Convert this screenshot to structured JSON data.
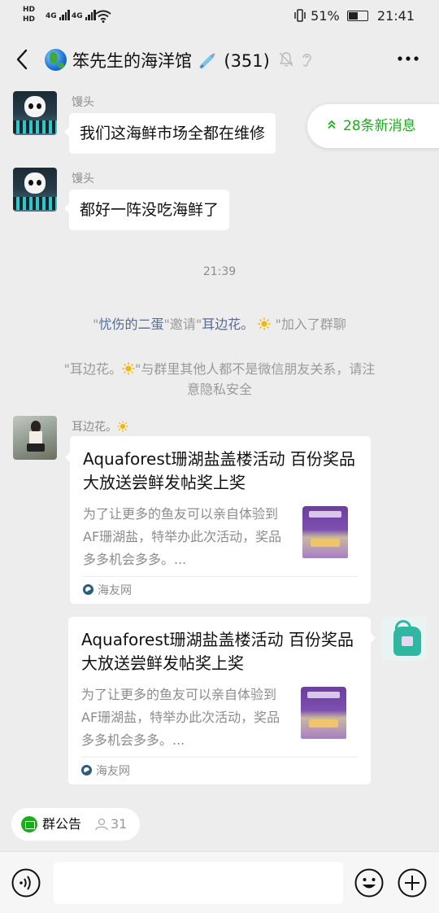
{
  "status_bar": {
    "left_top": "HD",
    "left_bottom": "HD",
    "net1": "4G",
    "net2": "4G",
    "battery_text": "51%",
    "time": "21:41",
    "battery_level": 0.51
  },
  "header": {
    "title_prefix": "笨先生的海洋馆",
    "title_suffix": "(351)"
  },
  "new_messages": {
    "label": "28条新消息"
  },
  "messages": [
    {
      "sender": "馒头",
      "text": "我们这海鲜市场全都在维修"
    },
    {
      "sender": "馒头",
      "text": "都好一阵没吃海鲜了"
    }
  ],
  "timestamp": "21:39",
  "system": {
    "invite": {
      "q1": "\"",
      "inviter": "忧伤的二蛋",
      "q2": "\"邀请\"",
      "invitee": "耳边花。",
      "q3": "\"加入了群聊"
    },
    "notice": {
      "line1_a": "\"耳边花。",
      "line1_b": "\"与群里其他人都不是微信朋友关系，请注",
      "line2": "意隐私安全"
    }
  },
  "link_sender": "耳边花。",
  "cards": [
    {
      "title": "Aquaforest珊湖盐盖楼活动 百份奖品大放送尝鲜发帖奖上奖",
      "desc": "为了让更多的鱼友可以亲自体验到AF珊湖盐，特举办此次活动，奖品多多机会多多。...",
      "source": "海友网"
    },
    {
      "title": "Aquaforest珊湖盐盖楼活动 百份奖品大放送尝鲜发帖奖上奖",
      "desc": "为了让更多的鱼友可以亲自体验到AF珊湖盐，特举办此次活动，奖品多多机会多多。...",
      "source": "海友网"
    }
  ],
  "bottom": {
    "notice_label": "群公告",
    "member_count": "31",
    "input_value": ""
  },
  "colors": {
    "accent_green": "#1aad19",
    "link_blue": "#576b95",
    "background": "#ededed"
  },
  "icons": [
    "back-icon",
    "globe-icon",
    "syringe-icon",
    "mute-icon",
    "ear-icon",
    "more-icon",
    "double-chevron-up-icon",
    "sun-icon",
    "site-icon",
    "announcement-icon",
    "person-icon",
    "voice-icon",
    "emoji-icon",
    "plus-icon"
  ]
}
